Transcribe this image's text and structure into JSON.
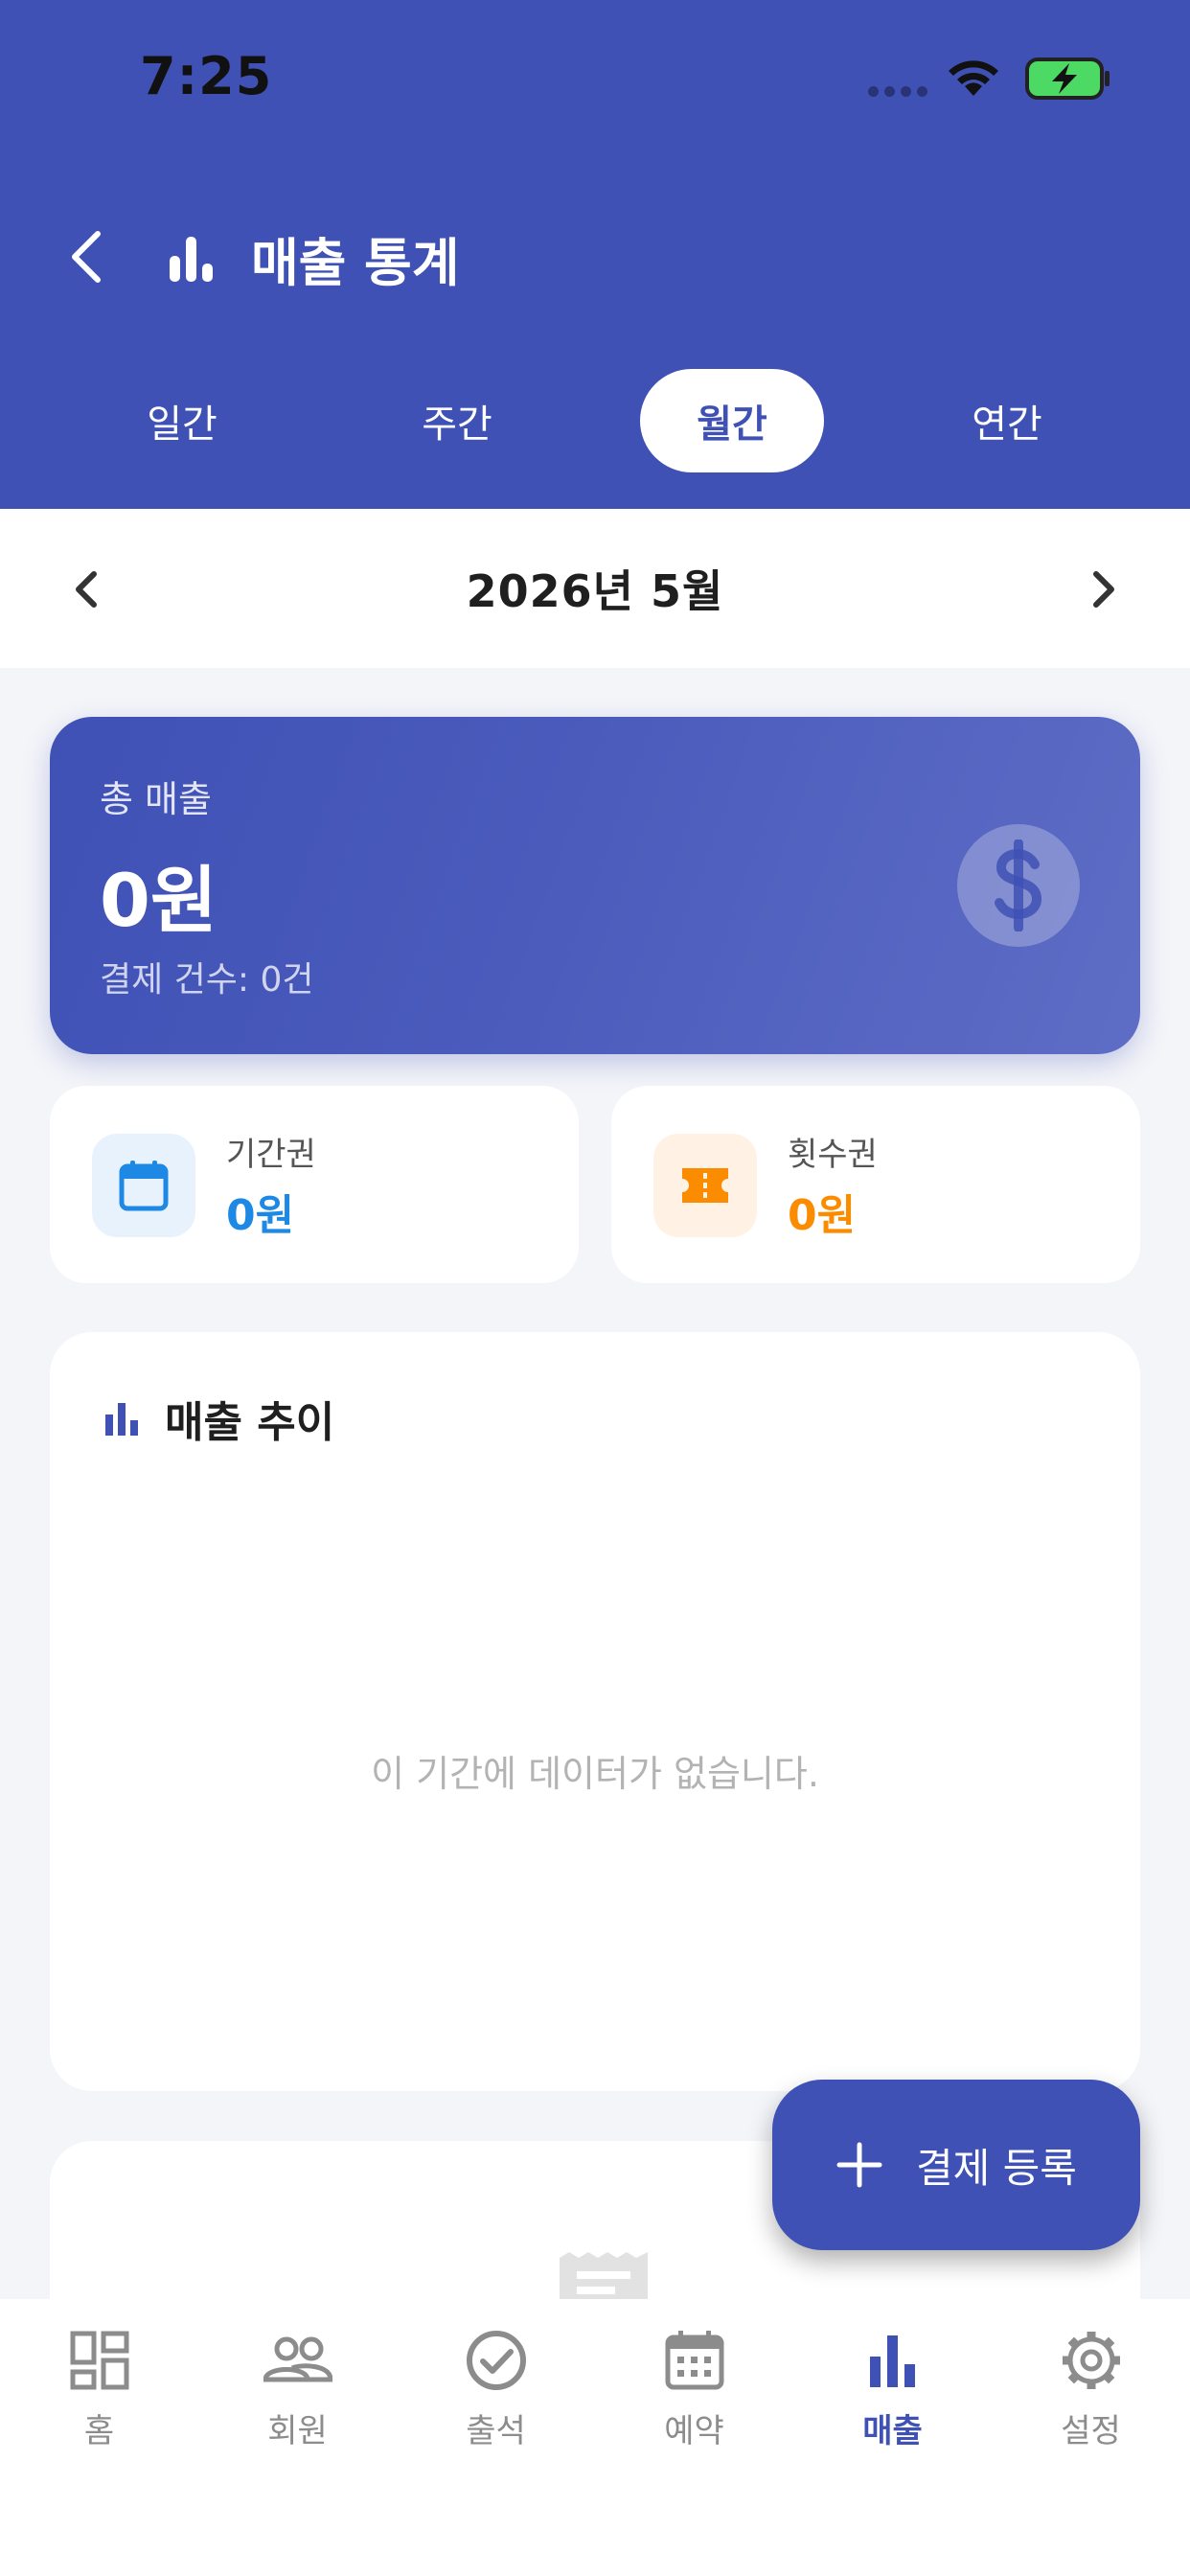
{
  "status_bar": {
    "time": "7:25"
  },
  "header": {
    "title": "매출 통계"
  },
  "tabs": [
    {
      "label": "일간",
      "active": false
    },
    {
      "label": "주간",
      "active": false
    },
    {
      "label": "월간",
      "active": true
    },
    {
      "label": "연간",
      "active": false
    }
  ],
  "date_nav": {
    "current": "2026년 5월"
  },
  "summary": {
    "total_label": "총 매출",
    "total_value": "0원",
    "count_text": "결제 건수: 0건"
  },
  "period_pass": {
    "label": "기간권",
    "value": "0원",
    "color": "#1E88E5"
  },
  "count_pass": {
    "label": "횟수권",
    "value": "0원",
    "color": "#FB8C00"
  },
  "trend": {
    "title": "매출 추이",
    "empty_message": "이 기간에 데이터가 없습니다."
  },
  "fab": {
    "label": "결제 등록"
  },
  "bottom_nav": [
    {
      "label": "홈",
      "icon": "dashboard-icon",
      "active": false
    },
    {
      "label": "회원",
      "icon": "people-icon",
      "active": false
    },
    {
      "label": "출석",
      "icon": "check-circle-icon",
      "active": false
    },
    {
      "label": "예약",
      "icon": "calendar-icon",
      "active": false
    },
    {
      "label": "매출",
      "icon": "bar-chart-icon",
      "active": true
    },
    {
      "label": "설정",
      "icon": "gear-icon",
      "active": false
    }
  ],
  "colors": {
    "primary": "#3F51B5",
    "background": "#F4F5F9",
    "inactive": "#8C8C8C"
  }
}
